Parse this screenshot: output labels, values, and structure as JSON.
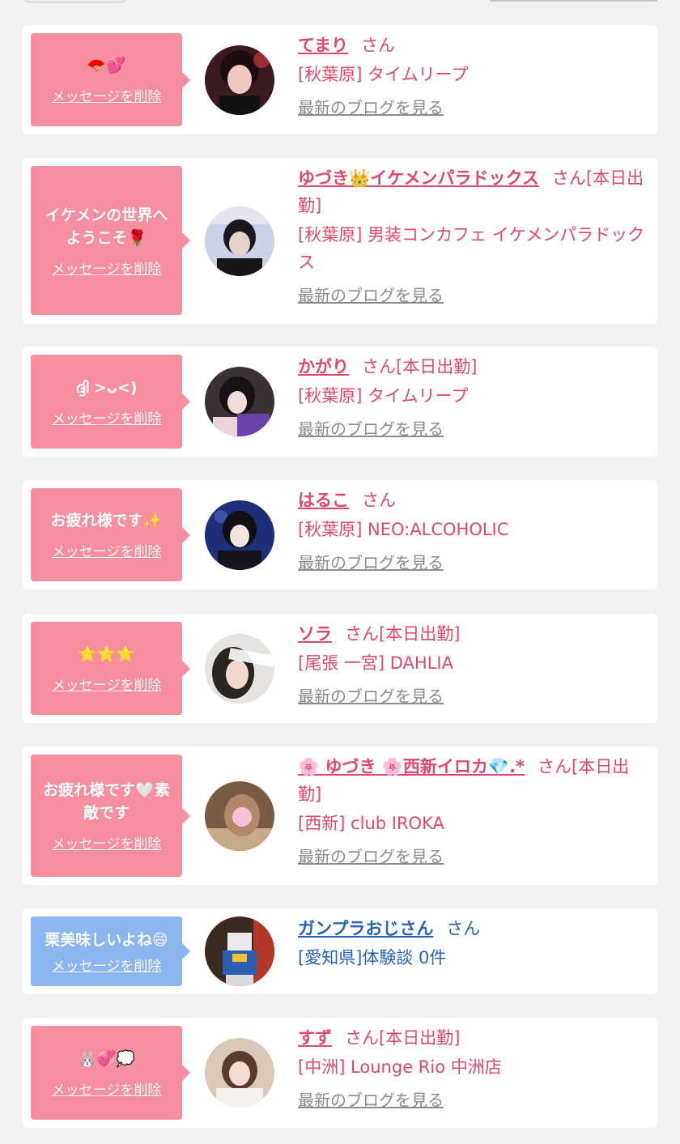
{
  "items": [
    {
      "message": "🪭💕",
      "delete_label": "メッセージを削除",
      "name": "てまり",
      "suffix": "さん",
      "shop": "[秋葉原] タイムリープ",
      "blog": "最新のブログを見る"
    },
    {
      "message": "イケメンの世界へようこそ🌹",
      "delete_label": "メッセージを削除",
      "name": "ゆづき👑イケメンパラドックス",
      "suffix": "さん[本日出勤]",
      "shop": "[秋葉原] 男装コンカフェ イケメンパラドックス",
      "blog": "最新のブログを見る"
    },
    {
      "message": "ദ്ദി >ᴗ<)",
      "delete_label": "メッセージを削除",
      "name": "かがり",
      "suffix": "さん[本日出勤]",
      "shop": "[秋葉原] タイムリープ",
      "blog": "最新のブログを見る"
    },
    {
      "message": "お疲れ様です✨",
      "delete_label": "メッセージを削除",
      "name": "はるこ",
      "suffix": "さん",
      "shop": "[秋葉原] NEO:ALCOHOLIC",
      "blog": "最新のブログを見る"
    },
    {
      "message": "⭐⭐⭐",
      "delete_label": "メッセージを削除",
      "name": "ソラ",
      "suffix": "さん[本日出勤]",
      "shop": "[尾張 一宮] DAHLIA",
      "blog": "最新のブログを見る"
    },
    {
      "message": "お疲れ様です🤍素敵です",
      "delete_label": "メッセージを削除",
      "name": "🌸 ゆづき 🌸西新イロカ💎.*",
      "suffix": "さん[本日出勤]",
      "shop": "[西新] club IROKA",
      "blog": "最新のブログを見る"
    },
    {
      "message": "栗美味しいよね😄",
      "delete_label": "メッセージを削除",
      "name": "ガンプラおじさん",
      "suffix": "さん",
      "shop": "[愛知県]体験談 0件"
    },
    {
      "message": "🐰💞💭",
      "delete_label": "メッセージを削除",
      "name": "すず",
      "suffix": "さん[本日出勤]",
      "shop": "[中洲] Lounge Rio 中洲店",
      "blog": "最新のブログを見る"
    }
  ],
  "colors": {
    "pink_bubble": "#f78fa0",
    "blue_bubble": "#8bb6f2",
    "pink_text": "#e0486c",
    "blue_text": "#2a62b8",
    "link_gray": "#8c8c8c",
    "background": "#f2f2f2"
  }
}
